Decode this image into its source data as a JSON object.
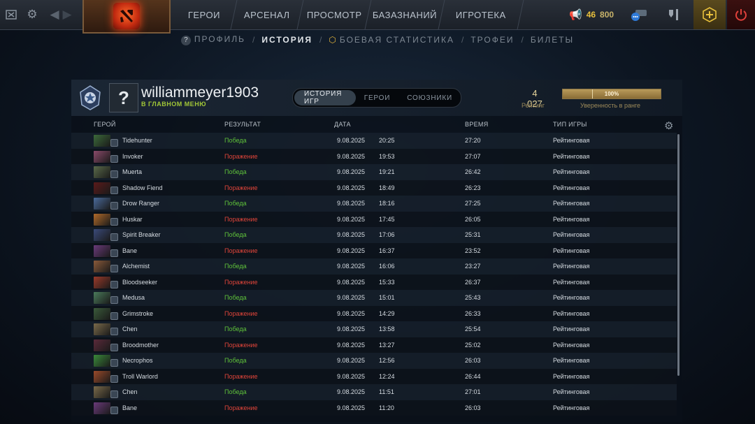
{
  "topbar": {
    "nav": [
      "ГЕРОИ",
      "АРСЕНАЛ",
      "ПРОСМОТР",
      "БАЗАЗНАНИЙ",
      "ИГРОТЕКА"
    ],
    "gold": "46",
    "shards": "800"
  },
  "subnav": {
    "items": [
      "ПРОФИЛЬ",
      "ИСТОРИЯ",
      "БОЕВАЯ СТАТИСТИКА",
      "ТРОФЕИ",
      "БИЛЕТЫ"
    ],
    "active_index": 1
  },
  "profile": {
    "username": "williammeyer1903",
    "status": "В ГЛАВНОМ МЕНЮ",
    "avatar_glyph": "?",
    "tabs": [
      "ИСТОРИЯ ИГР",
      "ГЕРОИ",
      "СОЮЗНИКИ"
    ],
    "active_tab": 0,
    "rating": "4 027",
    "rating_label": "Рейтинг",
    "confidence": "100%",
    "confidence_fraction": 1.0,
    "confidence_label": "Уверенность в ранге"
  },
  "table": {
    "headers": {
      "hero": "ГЕРОЙ",
      "result": "РЕЗУЛЬТАТ",
      "date": "ДАТА",
      "time": "ВРЕМЯ",
      "type": "ТИП ИГРЫ"
    },
    "rows": [
      {
        "hero": "Tidehunter",
        "result": "Победа",
        "win": true,
        "date": "9.08.2025",
        "clock": "20:25",
        "duration": "27:20",
        "type": "Рейтинговая",
        "color": "#3c6a3a"
      },
      {
        "hero": "Invoker",
        "result": "Поражение",
        "win": false,
        "date": "9.08.2025",
        "clock": "19:53",
        "duration": "27:07",
        "type": "Рейтинговая",
        "color": "#8a4a6a"
      },
      {
        "hero": "Muerta",
        "result": "Победа",
        "win": true,
        "date": "9.08.2025",
        "clock": "19:21",
        "duration": "26:42",
        "type": "Рейтинговая",
        "color": "#5a6a4a"
      },
      {
        "hero": "Shadow Fiend",
        "result": "Поражение",
        "win": false,
        "date": "9.08.2025",
        "clock": "18:49",
        "duration": "26:23",
        "type": "Рейтинговая",
        "color": "#5a1a1a"
      },
      {
        "hero": "Drow Ranger",
        "result": "Победа",
        "win": true,
        "date": "9.08.2025",
        "clock": "18:16",
        "duration": "27:25",
        "type": "Рейтинговая",
        "color": "#4a6a9a"
      },
      {
        "hero": "Huskar",
        "result": "Поражение",
        "win": false,
        "date": "9.08.2025",
        "clock": "17:45",
        "duration": "26:05",
        "type": "Рейтинговая",
        "color": "#b06a2a"
      },
      {
        "hero": "Spirit Breaker",
        "result": "Победа",
        "win": true,
        "date": "9.08.2025",
        "clock": "17:06",
        "duration": "25:31",
        "type": "Рейтинговая",
        "color": "#3a4a7a"
      },
      {
        "hero": "Bane",
        "result": "Поражение",
        "win": false,
        "date": "9.08.2025",
        "clock": "16:37",
        "duration": "23:52",
        "type": "Рейтинговая",
        "color": "#6a3a7a"
      },
      {
        "hero": "Alchemist",
        "result": "Победа",
        "win": true,
        "date": "9.08.2025",
        "clock": "16:06",
        "duration": "23:27",
        "type": "Рейтинговая",
        "color": "#8a5a3a"
      },
      {
        "hero": "Bloodseeker",
        "result": "Поражение",
        "win": false,
        "date": "9.08.2025",
        "clock": "15:33",
        "duration": "26:37",
        "type": "Рейтинговая",
        "color": "#9a3a2a"
      },
      {
        "hero": "Medusa",
        "result": "Победа",
        "win": true,
        "date": "9.08.2025",
        "clock": "15:01",
        "duration": "25:43",
        "type": "Рейтинговая",
        "color": "#4a7a5a"
      },
      {
        "hero": "Grimstroke",
        "result": "Поражение",
        "win": false,
        "date": "9.08.2025",
        "clock": "14:29",
        "duration": "26:33",
        "type": "Рейтинговая",
        "color": "#3a5a3a"
      },
      {
        "hero": "Chen",
        "result": "Победа",
        "win": true,
        "date": "9.08.2025",
        "clock": "13:58",
        "duration": "25:54",
        "type": "Рейтинговая",
        "color": "#7a6a4a"
      },
      {
        "hero": "Broodmother",
        "result": "Поражение",
        "win": false,
        "date": "9.08.2025",
        "clock": "13:27",
        "duration": "25:02",
        "type": "Рейтинговая",
        "color": "#5a2a3a"
      },
      {
        "hero": "Necrophos",
        "result": "Победа",
        "win": true,
        "date": "9.08.2025",
        "clock": "12:56",
        "duration": "26:03",
        "type": "Рейтинговая",
        "color": "#3a8a3a"
      },
      {
        "hero": "Troll Warlord",
        "result": "Поражение",
        "win": false,
        "date": "9.08.2025",
        "clock": "12:24",
        "duration": "26:44",
        "type": "Рейтинговая",
        "color": "#9a4a2a"
      },
      {
        "hero": "Chen",
        "result": "Победа",
        "win": true,
        "date": "9.08.2025",
        "clock": "11:51",
        "duration": "27:01",
        "type": "Рейтинговая",
        "color": "#7a6a4a"
      },
      {
        "hero": "Bane",
        "result": "Поражение",
        "win": false,
        "date": "9.08.2025",
        "clock": "11:20",
        "duration": "26:03",
        "type": "Рейтинговая",
        "color": "#6a3a7a"
      }
    ]
  }
}
